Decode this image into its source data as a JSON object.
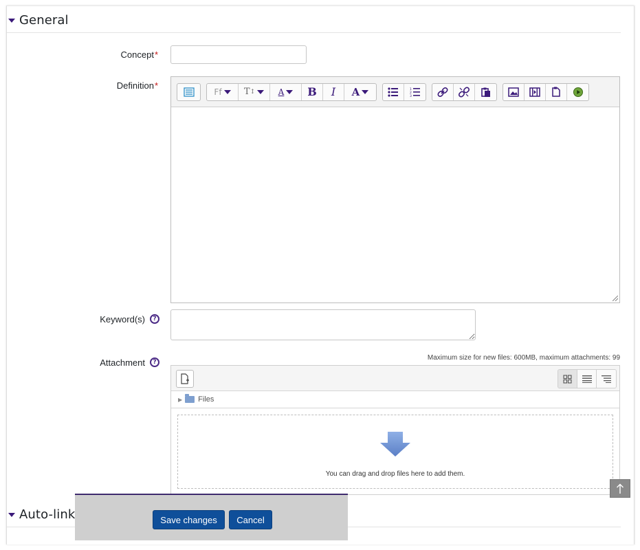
{
  "sections": {
    "general_title": "General",
    "autolink_title": "Auto-linki"
  },
  "fields": {
    "concept_label": "Concept",
    "definition_label": "Definition",
    "keywords_label": "Keyword(s)",
    "attachment_label": "Attachment",
    "required_marker": "*",
    "help_marker": "?"
  },
  "editor": {
    "toolbar_groups": [
      [
        "html-editor-icon"
      ],
      [
        "font-family-dropdown",
        "font-size-dropdown",
        "text-style-dropdown",
        "bold",
        "italic",
        "font-color-dropdown"
      ],
      [
        "unordered-list",
        "ordered-list"
      ],
      [
        "link",
        "unlink",
        "paste"
      ],
      [
        "image",
        "media",
        "file",
        "record"
      ]
    ],
    "font_label": "Ff",
    "size_label": "T",
    "style_label": "A",
    "bold_label": "B",
    "italic_label": "I",
    "color_label": "A"
  },
  "attachment": {
    "max_size_text": "Maximum size for new files: 600MB, maximum attachments: 99",
    "path_label": "Files",
    "drop_text": "You can drag and drop files here to add them."
  },
  "footer": {
    "save_label": "Save changes",
    "cancel_label": "Cancel"
  },
  "colors": {
    "accent": "#3b1a7a",
    "button": "#0f4f9a",
    "required": "#c41717",
    "drop_arrow": "#6c8fd1"
  }
}
